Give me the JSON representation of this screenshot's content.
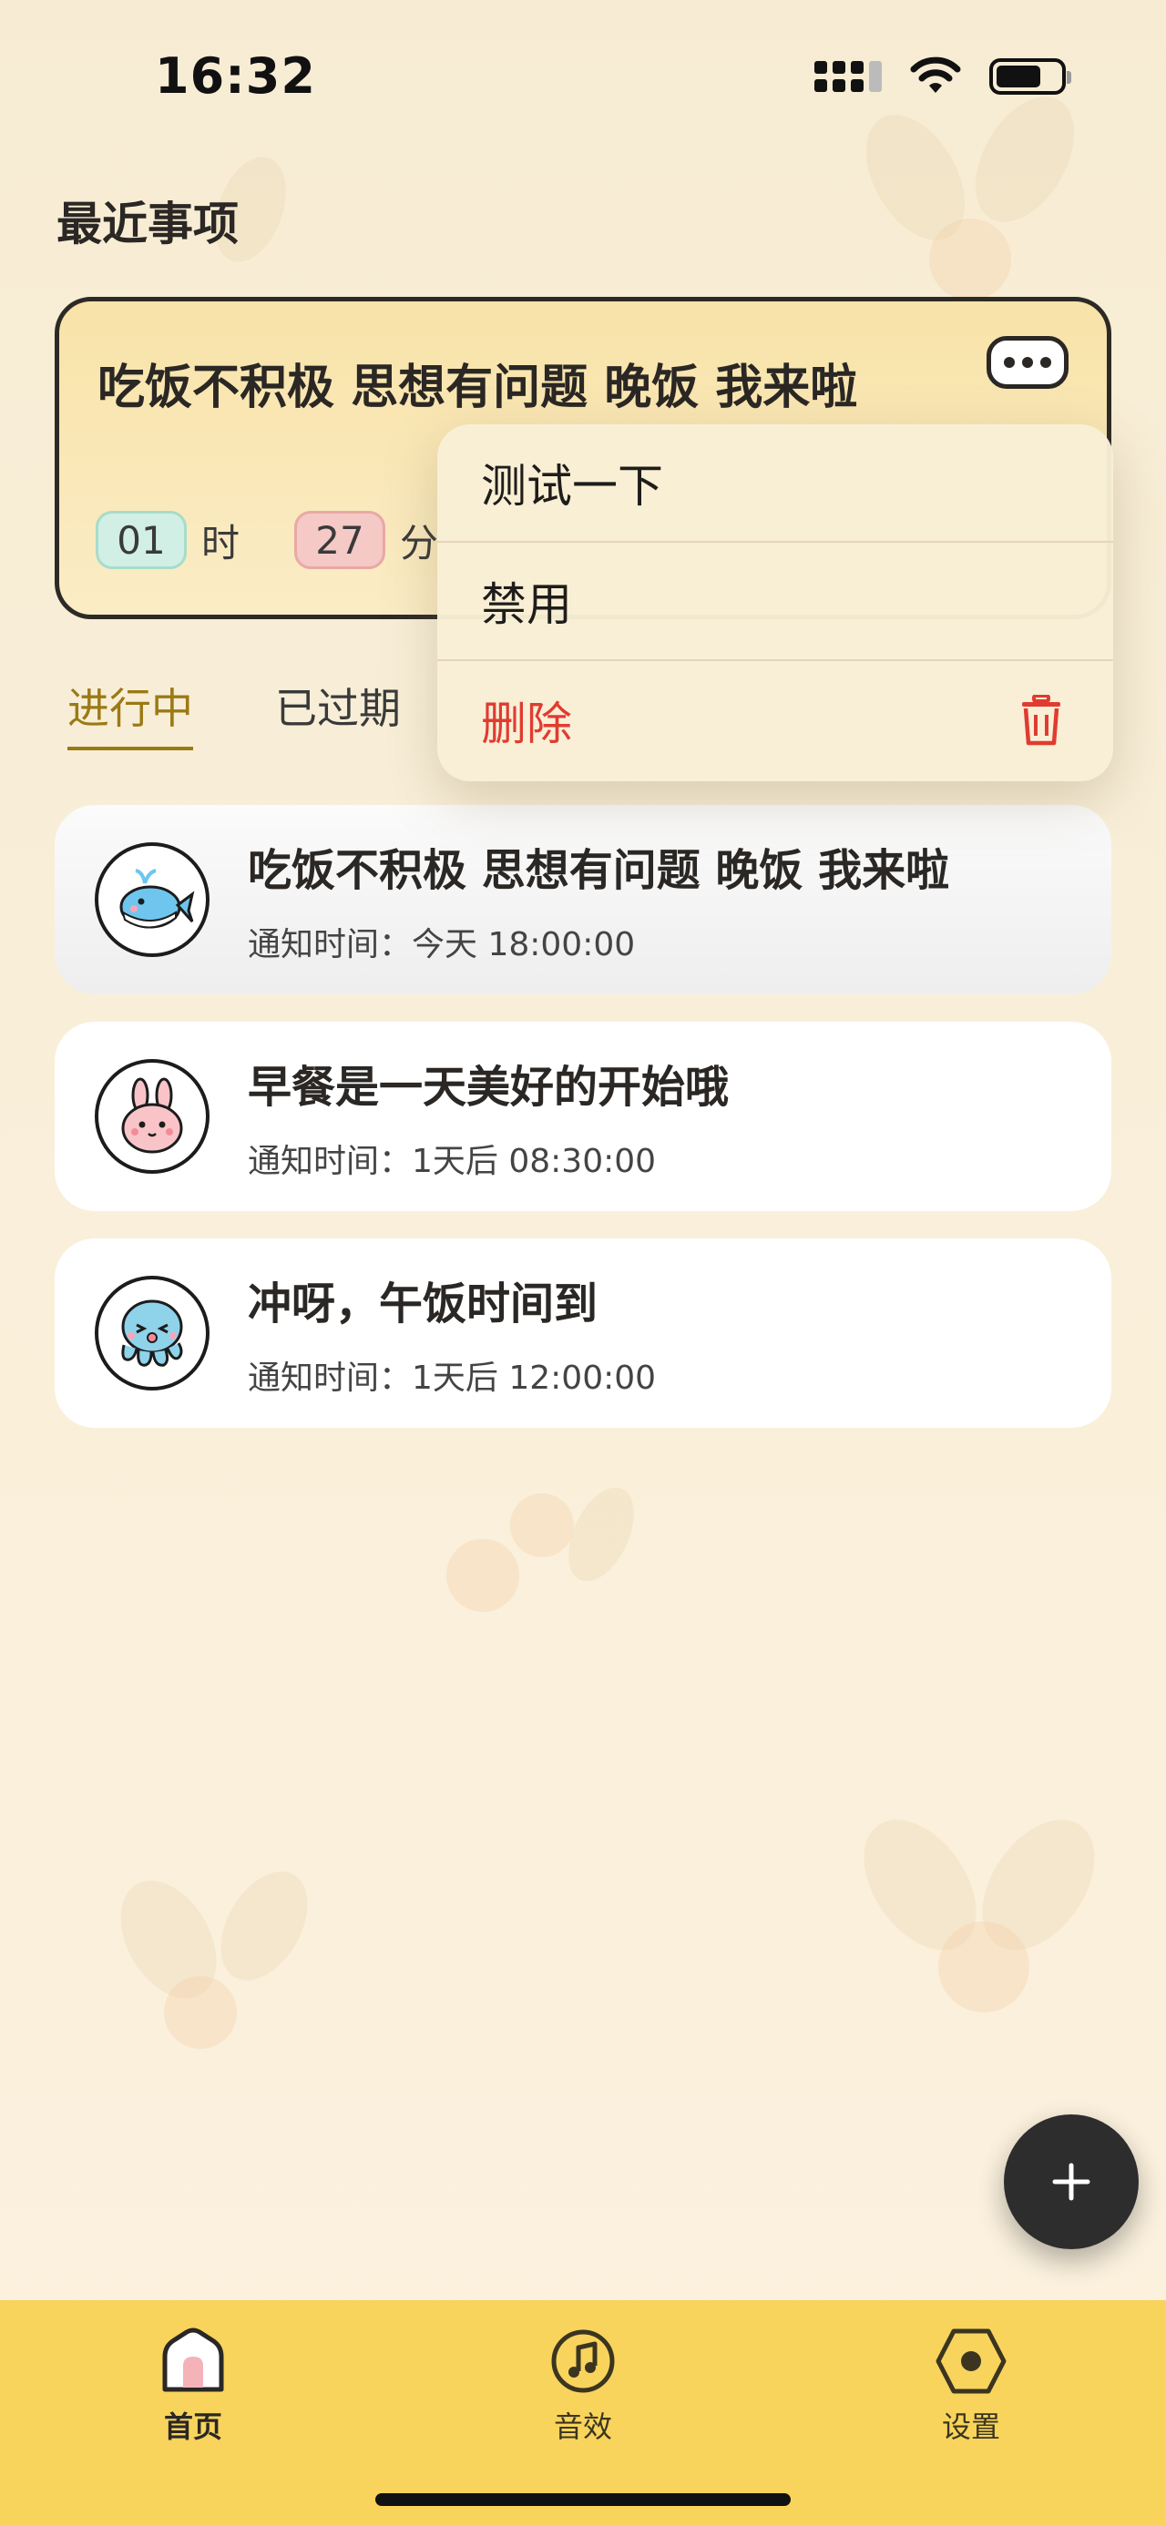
{
  "status_bar": {
    "time": "16:32"
  },
  "page_title": "最近事项",
  "recent": {
    "title": "吃饭不积极 思想有问题 晚饭 我来啦",
    "hours": "01",
    "hours_unit": "时",
    "minutes": "27",
    "minutes_unit": "分"
  },
  "tabs": [
    {
      "label": "进行中",
      "active": true
    },
    {
      "label": "已过期",
      "active": false
    }
  ],
  "menu": {
    "items": [
      {
        "label": "测试一下"
      },
      {
        "label": "禁用"
      },
      {
        "label": "删除",
        "icon": "trash-icon",
        "color": "#e13b30"
      }
    ]
  },
  "list": [
    {
      "title": "吃饭不积极 思想有问题 晚饭 我来啦",
      "subtitle": "通知时间：今天 18:00:00",
      "icon": "whale-icon"
    },
    {
      "title": "早餐是一天美好的开始哦",
      "subtitle": "通知时间：1天后 08:30:00",
      "icon": "bunny-icon"
    },
    {
      "title": "冲呀，午饭时间到",
      "subtitle": "通知时间：1天后 12:00:00",
      "icon": "octopus-icon"
    }
  ],
  "fab": {
    "icon": "plus-icon"
  },
  "tabbar": {
    "items": [
      {
        "label": "首页",
        "icon": "home-icon",
        "active": true
      },
      {
        "label": "音效",
        "icon": "music-icon",
        "active": false
      },
      {
        "label": "设置",
        "icon": "settings-hex-icon",
        "active": false
      }
    ]
  },
  "colors": {
    "accent": "#9b7a14",
    "danger": "#e13b30",
    "tabbar": "#f8d45c",
    "card": "#f8e3a8"
  }
}
